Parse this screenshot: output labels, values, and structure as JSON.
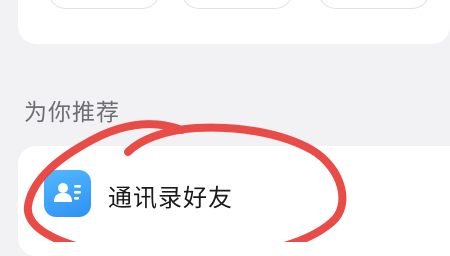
{
  "section": {
    "title": "为你推荐"
  },
  "recommend": {
    "items": [
      {
        "label": "通讯录好友",
        "icon": "contacts-icon",
        "icon_color": "#3b9bf8"
      }
    ]
  },
  "annotation": {
    "color": "#e8413c"
  }
}
